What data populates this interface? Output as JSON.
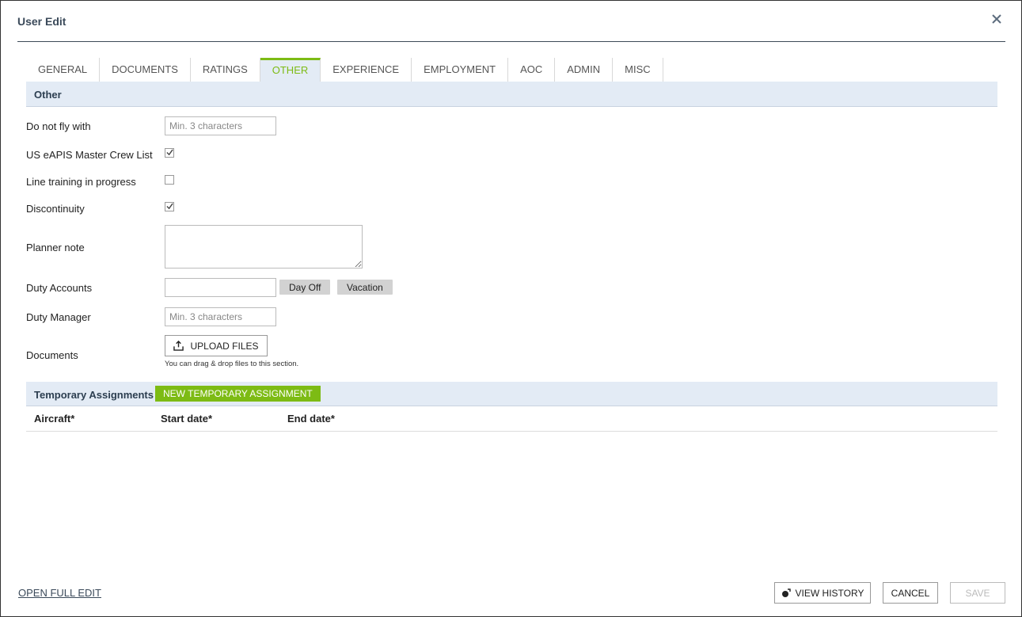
{
  "dialog": {
    "title": "User Edit"
  },
  "tabs": [
    {
      "label": "GENERAL"
    },
    {
      "label": "DOCUMENTS"
    },
    {
      "label": "RATINGS"
    },
    {
      "label": "OTHER"
    },
    {
      "label": "EXPERIENCE"
    },
    {
      "label": "EMPLOYMENT"
    },
    {
      "label": "AOC"
    },
    {
      "label": "ADMIN"
    },
    {
      "label": "MISC"
    }
  ],
  "active_tab": "OTHER",
  "other": {
    "section_title": "Other",
    "do_not_fly_with": {
      "label": "Do not fly with",
      "placeholder": "Min. 3 characters",
      "value": ""
    },
    "eapis": {
      "label": "US eAPIS Master Crew List",
      "checked": true
    },
    "line_training": {
      "label": "Line training in progress",
      "checked": false
    },
    "discontinuity": {
      "label": "Discontinuity",
      "checked": true
    },
    "planner_note": {
      "label": "Planner note",
      "value": ""
    },
    "duty_accounts": {
      "label": "Duty Accounts",
      "value": "",
      "day_off_label": "Day Off",
      "vacation_label": "Vacation"
    },
    "duty_manager": {
      "label": "Duty Manager",
      "placeholder": "Min. 3 characters",
      "value": ""
    },
    "documents": {
      "label": "Documents",
      "upload_label": "UPLOAD FILES",
      "hint": "You can drag & drop files to this section."
    }
  },
  "temporary": {
    "section_title": "Temporary Assignments",
    "new_button": "NEW TEMPORARY ASSIGNMENT",
    "columns": [
      "Aircraft*",
      "Start date*",
      "End date*"
    ]
  },
  "footer": {
    "open_full_edit": "OPEN FULL EDIT",
    "view_history": "VIEW HISTORY",
    "cancel": "CANCEL",
    "save": "SAVE"
  },
  "colors": {
    "accent": "#7dbb14",
    "section_bg": "#e3ebf5",
    "title": "#3b4a5a"
  }
}
